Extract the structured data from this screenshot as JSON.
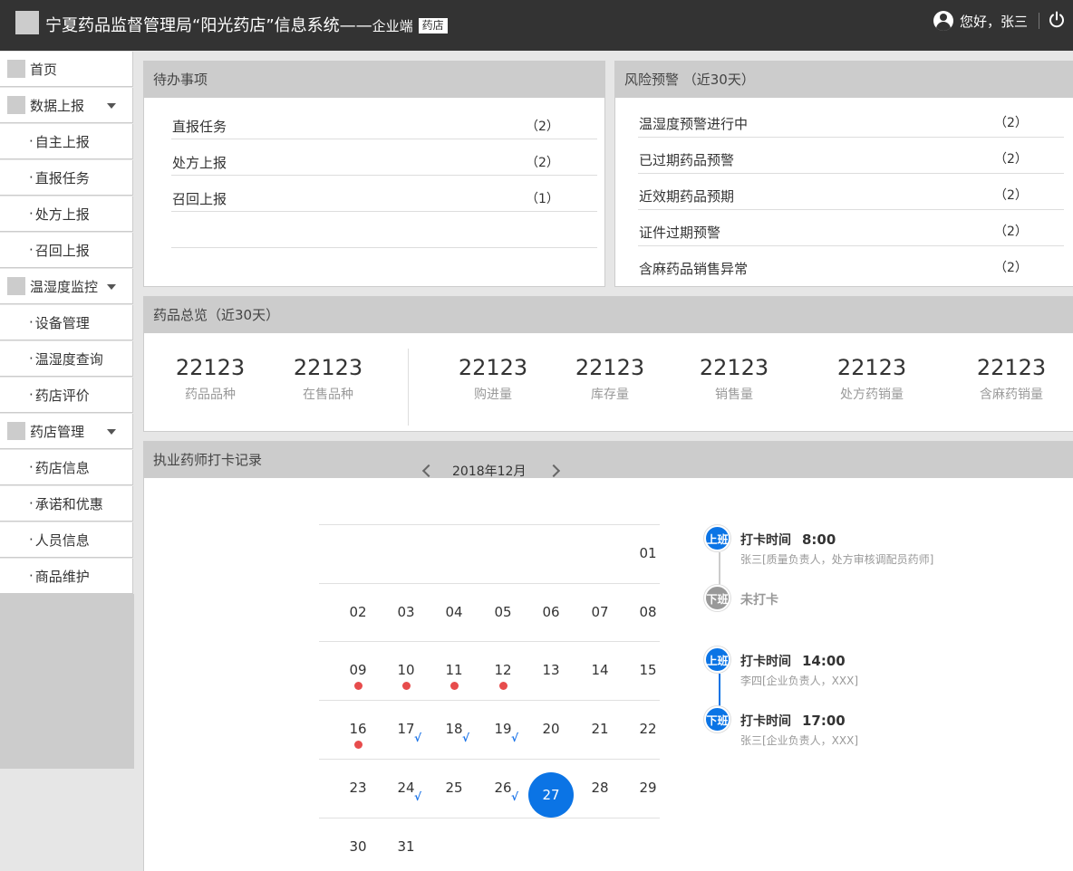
{
  "header": {
    "title": "宁夏药品监督管理局“阳光药店”信息系统——",
    "title_suffix": "企业端",
    "badge": "药店",
    "greeting": "您好，张三"
  },
  "sidebar": {
    "items": [
      {
        "label": "首页",
        "type": "top"
      },
      {
        "label": "数据上报",
        "type": "group"
      },
      {
        "label": "自主上报",
        "type": "sub"
      },
      {
        "label": "直报任务",
        "type": "sub"
      },
      {
        "label": "处方上报",
        "type": "sub"
      },
      {
        "label": "召回上报",
        "type": "sub"
      },
      {
        "label": "温湿度监控",
        "type": "group"
      },
      {
        "label": "设备管理",
        "type": "sub"
      },
      {
        "label": "温湿度查询",
        "type": "sub"
      },
      {
        "label": "药店评价",
        "type": "sub"
      },
      {
        "label": "药店管理",
        "type": "group"
      },
      {
        "label": "药店信息",
        "type": "sub"
      },
      {
        "label": "承诺和优惠",
        "type": "sub"
      },
      {
        "label": "人员信息",
        "type": "sub"
      },
      {
        "label": "商品维护",
        "type": "sub"
      }
    ]
  },
  "todo": {
    "title": "待办事项",
    "items": [
      {
        "label": "直报任务",
        "count": "（2）"
      },
      {
        "label": "处方上报",
        "count": "（2）"
      },
      {
        "label": "召回上报",
        "count": "（1）"
      }
    ]
  },
  "risk": {
    "title": "风险预警 （近30天）",
    "items": [
      {
        "label": "温湿度预警进行中",
        "count": "（2）"
      },
      {
        "label": "已过期药品预警",
        "count": "（2）"
      },
      {
        "label": "近效期药品预期",
        "count": "（2）"
      },
      {
        "label": "证件过期预警",
        "count": "（2）"
      },
      {
        "label": "含麻药品销售异常",
        "count": "（2）"
      }
    ]
  },
  "overview": {
    "title": "药品总览（近30天）",
    "stats": [
      {
        "value": "22123",
        "label": "药品品种"
      },
      {
        "value": "22123",
        "label": "在售品种"
      },
      {
        "value": "22123",
        "label": "购进量"
      },
      {
        "value": "22123",
        "label": "库存量"
      },
      {
        "value": "22123",
        "label": "销售量"
      },
      {
        "value": "22123",
        "label": "处方药销量"
      },
      {
        "value": "22123",
        "label": "含麻药销量"
      }
    ]
  },
  "checkin": {
    "title": "执业药师打卡记录",
    "calendar": {
      "month_label": "2018年12月",
      "today": "27",
      "days": [
        "01",
        "02",
        "03",
        "04",
        "05",
        "06",
        "07",
        "08",
        "09",
        "10",
        "11",
        "12",
        "13",
        "14",
        "15",
        "16",
        "17",
        "18",
        "19",
        "20",
        "21",
        "22",
        "23",
        "24",
        "25",
        "26",
        "27",
        "28",
        "29",
        "30",
        "31"
      ],
      "missed": [
        "09",
        "10",
        "11",
        "12",
        "16"
      ],
      "checked": [
        "17",
        "18",
        "19",
        "24",
        "26"
      ],
      "check_mark": "√"
    },
    "records": [
      {
        "badge": "上班",
        "title": "打卡时间",
        "time": "8:00",
        "detail": "张三[质量负责人，处方审核调配员药师]",
        "kind": "on"
      },
      {
        "badge": "下班",
        "title": "未打卡",
        "time": "",
        "detail": "",
        "kind": "off"
      },
      {
        "badge": "上班",
        "title": "打卡时间",
        "time": "14:00",
        "detail": "李四[企业负责人，XXX]",
        "kind": "on"
      },
      {
        "badge": "下班",
        "title": "打卡时间",
        "time": "17:00",
        "detail": "张三[企业负责人，XXX]",
        "kind": "on"
      }
    ]
  }
}
